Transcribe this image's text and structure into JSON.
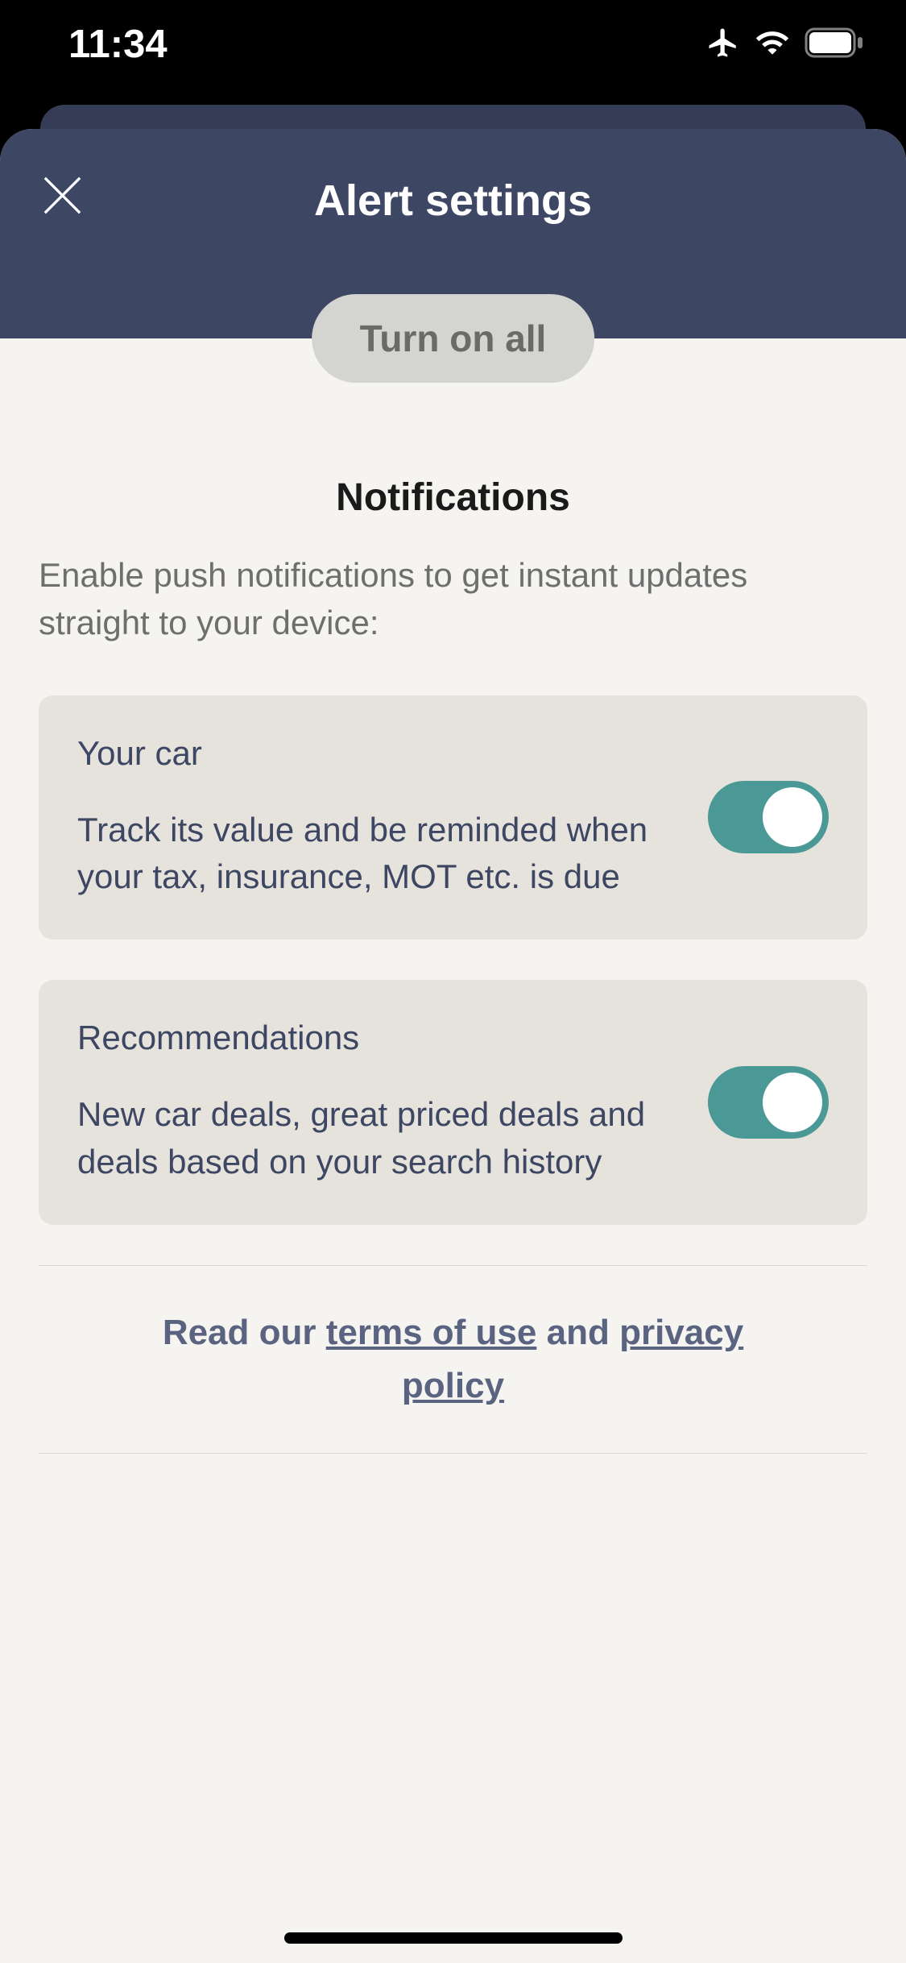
{
  "status": {
    "time": "11:34"
  },
  "header": {
    "title": "Alert settings",
    "turn_on_all": "Turn on all"
  },
  "section": {
    "title": "Notifications",
    "description": "Enable push notifications to get instant updates straight to your device:"
  },
  "cards": [
    {
      "title": "Your car",
      "body": "Track its value and be reminded when your tax, insurance, MOT etc. is due"
    },
    {
      "title": "Recommendations",
      "body": "New car deals, great priced deals and deals based on your search history"
    }
  ],
  "legal": {
    "prefix": "Read our ",
    "terms": "terms of use",
    "middle": " and ",
    "privacy": "privacy policy"
  }
}
